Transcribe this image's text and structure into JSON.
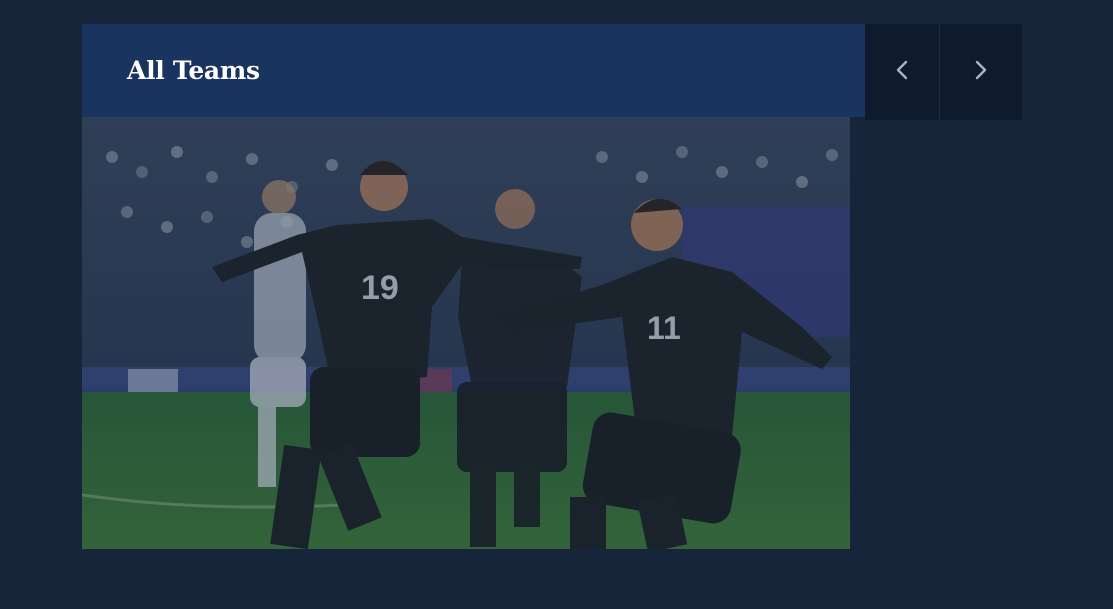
{
  "header": {
    "title": "All Teams"
  },
  "nav": {
    "prev_icon": "chevron-left-icon",
    "next_icon": "chevron-right-icon"
  },
  "photo": {
    "players": [
      {
        "number": "19"
      },
      {
        "number": "11"
      }
    ]
  },
  "colors": {
    "background": "#17253a",
    "header": "#1a3460",
    "nav_button": "#0f1a2c"
  }
}
